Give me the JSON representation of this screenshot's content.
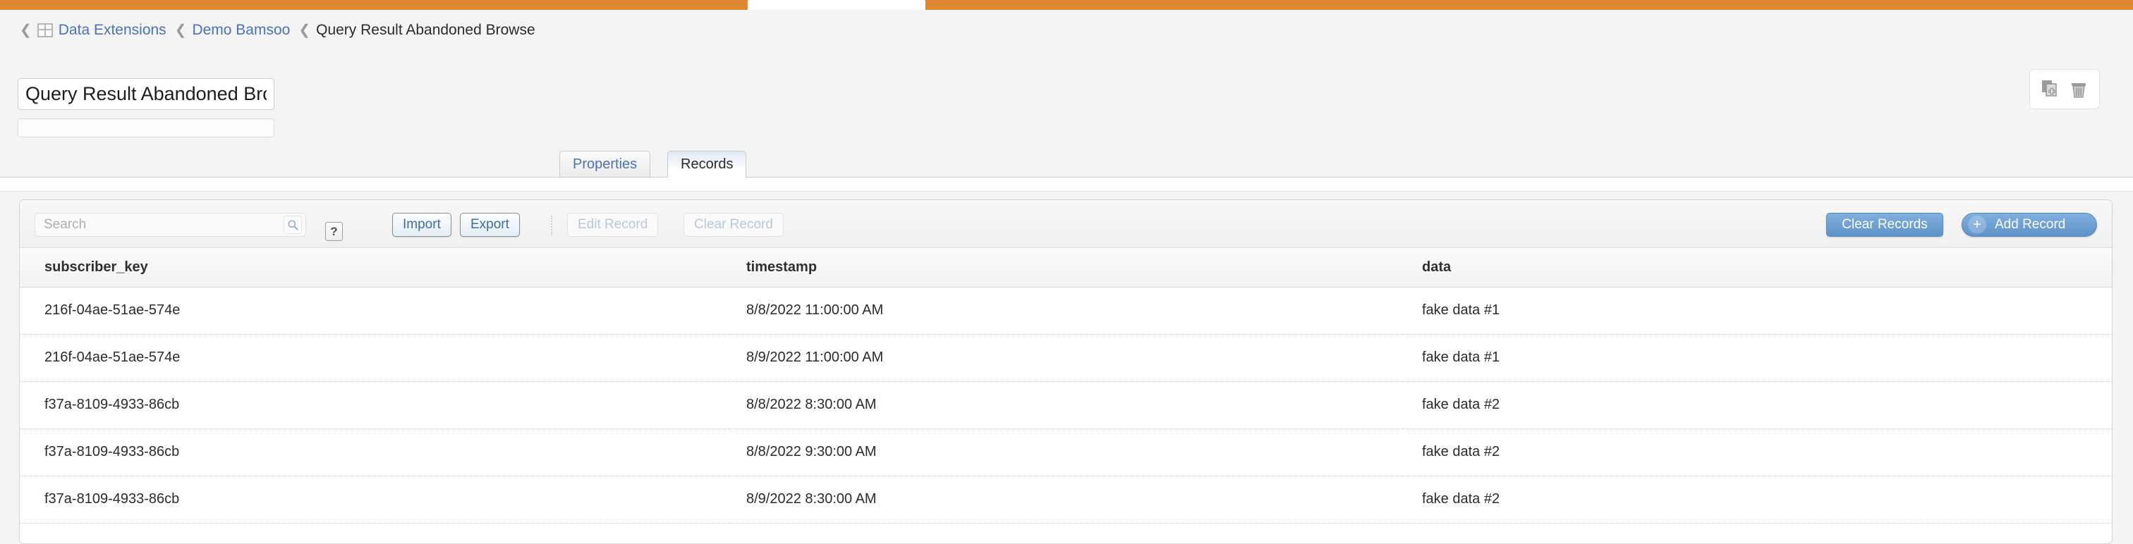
{
  "appbar": {
    "accent_color": "#df8832",
    "tab_label": ""
  },
  "breadcrumb": {
    "chevron": "❮",
    "grid_icon": "data-extensions-grid-icon",
    "items": [
      {
        "label": "Data Extensions",
        "type": "link"
      },
      {
        "label": "Demo Bamsoo",
        "type": "link"
      },
      {
        "label": "Query Result Abandoned Browse",
        "type": "current"
      }
    ]
  },
  "header": {
    "title_value": "Query Result Abandoned Browse",
    "title_placeholder": "",
    "subtitle_value": "",
    "subtitle_placeholder": "",
    "actions": [
      {
        "name": "duplicate-icon",
        "label": "Duplicate"
      },
      {
        "name": "delete-icon",
        "label": "Delete"
      }
    ]
  },
  "tabs": [
    {
      "label": "Properties",
      "active": false
    },
    {
      "label": "Records",
      "active": true
    }
  ],
  "toolbar": {
    "search_placeholder": "Search",
    "search_value": "",
    "search_icon": "magnifier-icon",
    "help_label": "?",
    "buttons": [
      {
        "label": "Import",
        "disabled": false
      },
      {
        "label": "Export",
        "disabled": false
      },
      {
        "label": "Edit Record",
        "disabled": true
      },
      {
        "label": "Clear Record",
        "disabled": true
      }
    ],
    "clear_records_label": "Clear Records",
    "add_record_label": "Add Record",
    "add_record_icon": "+",
    "primary_color": "#6b9ed2"
  },
  "table": {
    "columns": [
      "subscriber_key",
      "timestamp",
      "data"
    ],
    "rows": [
      [
        "216f-04ae-51ae-574e",
        "8/8/2022 11:00:00 AM",
        "fake data #1"
      ],
      [
        "216f-04ae-51ae-574e",
        "8/9/2022 11:00:00 AM",
        "fake data #1"
      ],
      [
        "f37a-8109-4933-86cb",
        "8/8/2022 8:30:00 AM",
        "fake data #2"
      ],
      [
        "f37a-8109-4933-86cb",
        "8/8/2022 9:30:00 AM",
        "fake data #2"
      ],
      [
        "f37a-8109-4933-86cb",
        "8/9/2022 8:30:00 AM",
        "fake data #2"
      ]
    ]
  }
}
